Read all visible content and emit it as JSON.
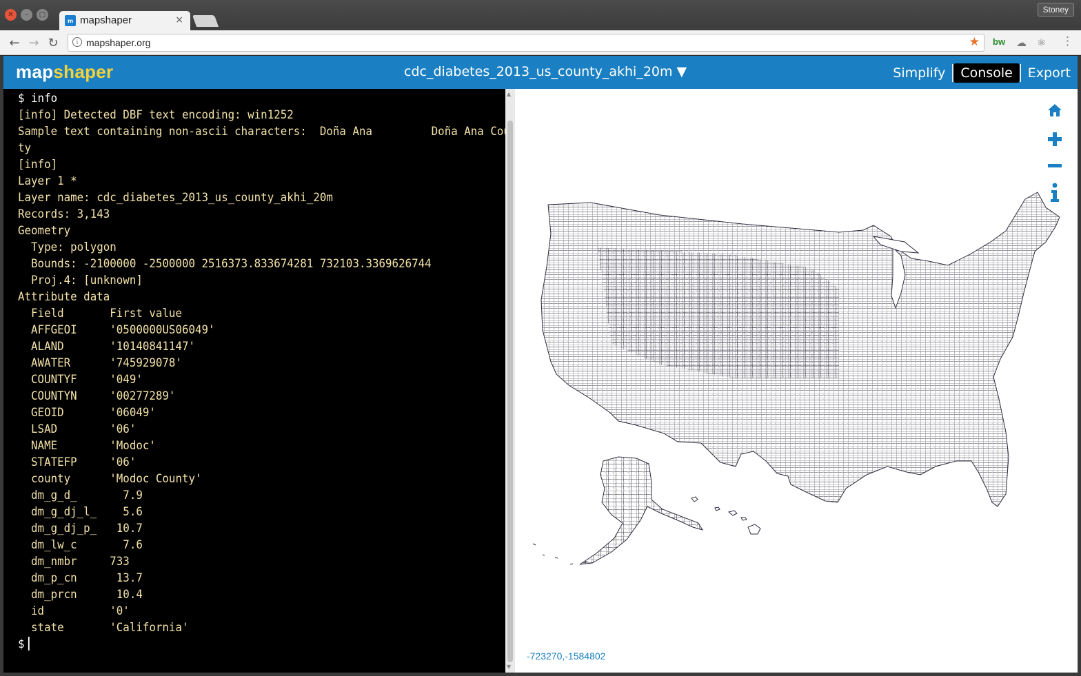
{
  "browser": {
    "tab_title": "mapshaper",
    "tab_close": "×",
    "url": "mapshaper.org",
    "profile_name": "Stoney"
  },
  "app": {
    "logo_part1": "map",
    "logo_part2": "shaper",
    "layer_name": "cdc_diabetes_2013_us_county_akhi_20m ▼",
    "menu": {
      "simplify": "Simplify",
      "console": "Console",
      "export": "Export"
    },
    "brand_color": "#1a80c3",
    "logo_accent": "#f6d23a"
  },
  "console": {
    "lines": [
      "$ info",
      "[info] Detected DBF text encoding: win1252",
      "Sample text containing non-ascii characters:  Doña Ana         Doña Ana Coun",
      "ty",
      "[info]",
      "Layer 1 *",
      "Layer name: cdc_diabetes_2013_us_county_akhi_20m",
      "Records: 3,143",
      "Geometry",
      "  Type: polygon",
      "  Bounds: -2100000 -2500000 2516373.833674281 732103.3369626744",
      "  Proj.4: [unknown]",
      "Attribute data",
      "  Field       First value",
      "  AFFGEOI     '0500000US06049'",
      "  ALAND       '10140841147'",
      "  AWATER      '745929078'",
      "  COUNTYF     '049'",
      "  COUNTYN     '00277289'",
      "  GEOID       '06049'",
      "  LSAD        '06'",
      "  NAME        'Modoc'",
      "  STATEFP     '06'",
      "  county      'Modoc County'",
      "  dm_g_d_       7.9",
      "  dm_g_dj_l_    5.6",
      "  dm_g_dj_p_   10.7",
      "  dm_lw_c       7.6",
      "  dm_nmbr     733",
      "  dm_p_cn      13.7",
      "  dm_prcn      10.4",
      "  id          '0'",
      "  state       'California'"
    ],
    "prompt": "$"
  },
  "map": {
    "coordinates": "-723270,-1584802",
    "tools": [
      "home-icon",
      "zoom-in-icon",
      "zoom-out-icon",
      "info-icon"
    ]
  }
}
